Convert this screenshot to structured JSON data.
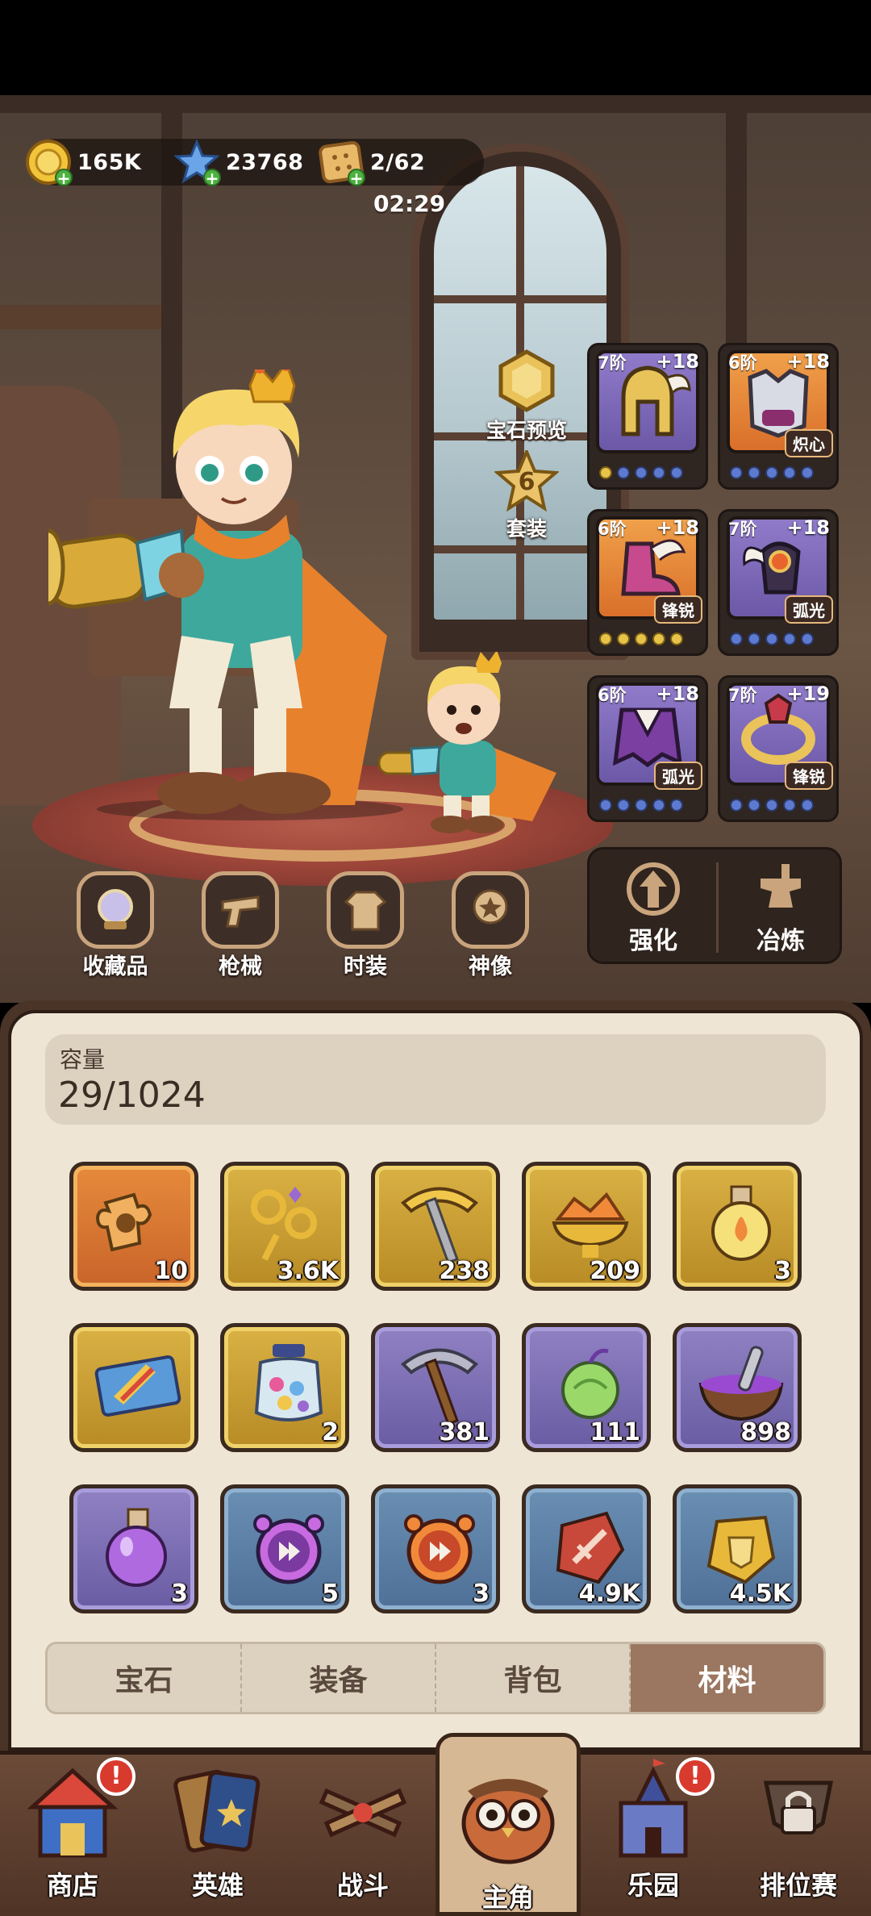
{
  "resources": {
    "gold": "165K",
    "stars": "23768",
    "stamina": "2/62",
    "timer": "02:29"
  },
  "side_buttons": {
    "gem_preview": "宝石预览",
    "set_count": "6",
    "set_label": "套装"
  },
  "equipment": [
    {
      "tier": "7阶",
      "level": "+18",
      "tag": "",
      "rarity": "purple"
    },
    {
      "tier": "6阶",
      "level": "+18",
      "tag": "炽心",
      "rarity": "orange"
    },
    {
      "tier": "6阶",
      "level": "+18",
      "tag": "锋锐",
      "rarity": "orange"
    },
    {
      "tier": "7阶",
      "level": "+18",
      "tag": "弧光",
      "rarity": "purple"
    },
    {
      "tier": "6阶",
      "level": "+18",
      "tag": "弧光",
      "rarity": "purple"
    },
    {
      "tier": "7阶",
      "level": "+19",
      "tag": "锋锐",
      "rarity": "purple"
    }
  ],
  "hero_buttons": {
    "collection": "收藏品",
    "firearms": "枪械",
    "fashion": "时装",
    "statue": "神像"
  },
  "upgrade": {
    "enhance": "强化",
    "refine": "冶炼"
  },
  "inventory": {
    "capacity_title": "容量",
    "capacity_value": "29/1024",
    "items": [
      {
        "count": "10",
        "rarity": "orange",
        "icon": "puzzle-icon"
      },
      {
        "count": "3.6K",
        "rarity": "gold",
        "icon": "key-icon"
      },
      {
        "count": "238",
        "rarity": "gold",
        "icon": "gold-pickaxe-icon"
      },
      {
        "count": "209",
        "rarity": "gold",
        "icon": "ore-bowl-icon"
      },
      {
        "count": "3",
        "rarity": "gold",
        "icon": "gold-potion-icon"
      },
      {
        "count": "",
        "rarity": "gold",
        "icon": "ticket-icon"
      },
      {
        "count": "2",
        "rarity": "gold",
        "icon": "candy-jar-icon"
      },
      {
        "count": "381",
        "rarity": "purple",
        "icon": "pickaxe-icon"
      },
      {
        "count": "111",
        "rarity": "purple",
        "icon": "fruit-icon"
      },
      {
        "count": "898",
        "rarity": "purple",
        "icon": "mortar-icon"
      },
      {
        "count": "3",
        "rarity": "purple",
        "icon": "purple-potion-icon"
      },
      {
        "count": "5",
        "rarity": "blue",
        "icon": "purple-clock-icon"
      },
      {
        "count": "3",
        "rarity": "blue",
        "icon": "orange-clock-icon"
      },
      {
        "count": "4.9K",
        "rarity": "blue",
        "icon": "sword-stone-icon"
      },
      {
        "count": "4.5K",
        "rarity": "blue",
        "icon": "shield-stone-icon"
      }
    ]
  },
  "tabs": [
    "宝石",
    "装备",
    "背包",
    "材料"
  ],
  "active_tab": "材料",
  "nav": [
    "商店",
    "英雄",
    "战斗",
    "主角",
    "乐园",
    "排位赛"
  ],
  "badge": "!",
  "colors": {
    "panel": "#efe5d4",
    "active_tab": "#9b7660",
    "nav": "#6b4a38"
  }
}
